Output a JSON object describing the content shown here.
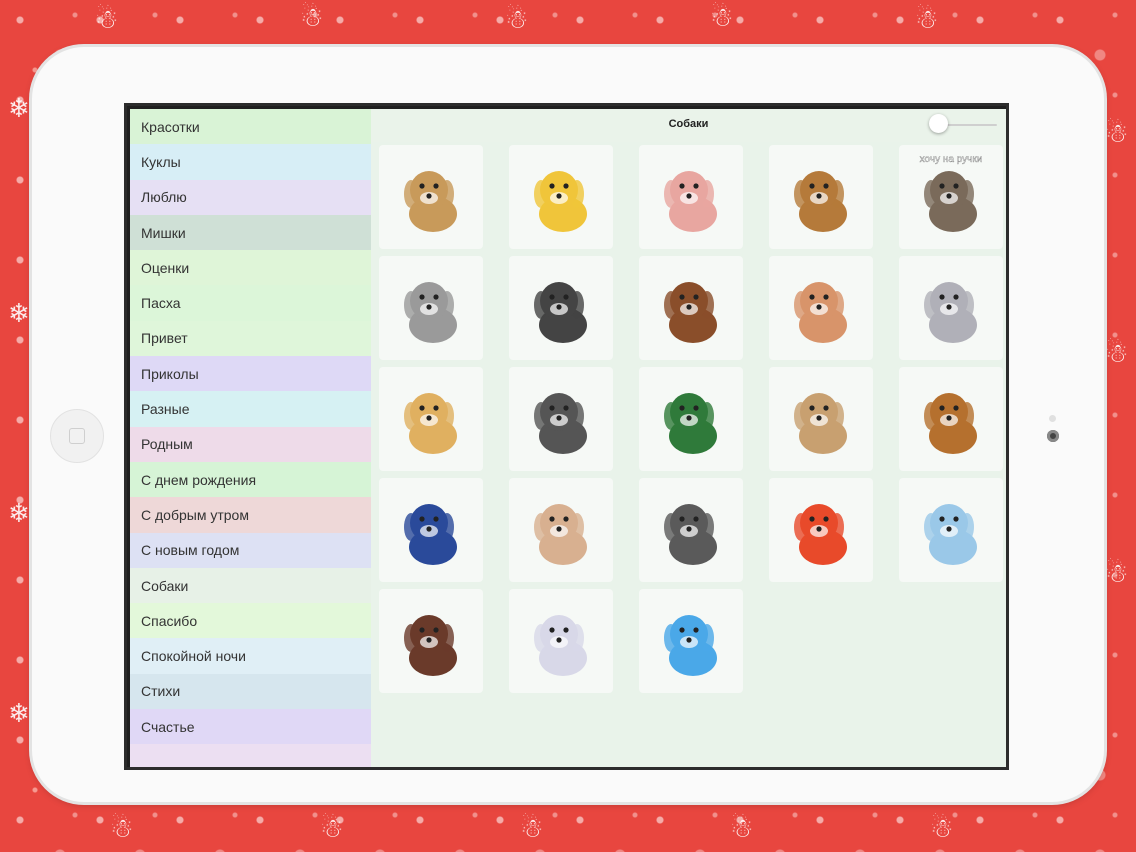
{
  "screen": {
    "title": "Собаки",
    "slider_value": 0
  },
  "categories": [
    {
      "label": "Красотки",
      "color": "#d9f3d6"
    },
    {
      "label": "Куклы",
      "color": "#d7eef6"
    },
    {
      "label": "Люблю",
      "color": "#e6e0f4"
    },
    {
      "label": "Мишки",
      "color": "#cfe0d6"
    },
    {
      "label": "Оценки",
      "color": "#dff5d8"
    },
    {
      "label": "Пасха",
      "color": "#dcf6d9"
    },
    {
      "label": "Привет",
      "color": "#dff6da"
    },
    {
      "label": "Приколы",
      "color": "#ded9f6"
    },
    {
      "label": "Разные",
      "color": "#d6f1f3"
    },
    {
      "label": "Родным",
      "color": "#eedbe9"
    },
    {
      "label": "С днем рождения",
      "color": "#d6f4d6"
    },
    {
      "label": "С добрым утром",
      "color": "#eed8d8"
    },
    {
      "label": "С новым годом",
      "color": "#dde1f4"
    },
    {
      "label": "Собаки",
      "color": "#e7f1e7"
    },
    {
      "label": "Спасибо",
      "color": "#e3f8da"
    },
    {
      "label": "Спокойной ночи",
      "color": "#e0eff6"
    },
    {
      "label": "Стихи",
      "color": "#d6e6ee"
    },
    {
      "label": "Счастье",
      "color": "#e0d8f6"
    },
    {
      "label": "",
      "color": "#ecdff2"
    }
  ],
  "gallery": [
    {
      "icon": "spaniel-puppy-icon",
      "color": "#c89a5a",
      "caption": ""
    },
    {
      "icon": "pluto-splash-icon",
      "color": "#f0c53a",
      "caption": ""
    },
    {
      "icon": "cartoon-stork-dog-icon",
      "color": "#e8a6a0",
      "caption": ""
    },
    {
      "icon": "puppy-bowl-icon",
      "color": "#b57a3a",
      "caption": ""
    },
    {
      "icon": "chihuahua-photo-icon",
      "color": "#7a6a5a",
      "caption": "хочу на ручки"
    },
    {
      "icon": "dalmatian-snowglobe-icon",
      "color": "#9a9a9a",
      "caption": ""
    },
    {
      "icon": "dalmatian-head-icon",
      "color": "#444444",
      "caption": ""
    },
    {
      "icon": "three-puppies-icon",
      "color": "#8a4e2a",
      "caption": ""
    },
    {
      "icon": "sleeping-puppy-kitten-icon",
      "color": "#d8946a",
      "caption": ""
    },
    {
      "icon": "dalmatians-group-icon",
      "color": "#b0b0b8",
      "caption": ""
    },
    {
      "icon": "puppy-flowers-icon",
      "color": "#e0b060",
      "caption": ""
    },
    {
      "icon": "dalmatian-puppy-icon",
      "color": "#555555",
      "caption": ""
    },
    {
      "icon": "sharpei-sweater-icon",
      "color": "#2f7a3a",
      "caption": ""
    },
    {
      "icon": "lying-puppy-icon",
      "color": "#c8a070",
      "caption": ""
    },
    {
      "icon": "puppy-sitting-icon",
      "color": "#b5702e",
      "caption": ""
    },
    {
      "icon": "puppy-in-boot-icon",
      "color": "#2a4a9a",
      "caption": ""
    },
    {
      "icon": "spaniel-pair-icon",
      "color": "#d8b090",
      "caption": ""
    },
    {
      "icon": "dog-on-street-photo-icon",
      "color": "#5a5a5a",
      "caption": ""
    },
    {
      "icon": "puppy-lollipop-icon",
      "color": "#e84a2a",
      "caption": ""
    },
    {
      "icon": "puppy-bed-icon",
      "color": "#9ac8e8",
      "caption": ""
    },
    {
      "icon": "sitting-longhair-dog-icon",
      "color": "#6a3a2a",
      "caption": ""
    },
    {
      "icon": "white-puppies-stack-icon",
      "color": "#d8d8e8",
      "caption": ""
    },
    {
      "icon": "blue-glitter-dog-icon",
      "color": "#4aa8e8",
      "caption": ""
    }
  ]
}
